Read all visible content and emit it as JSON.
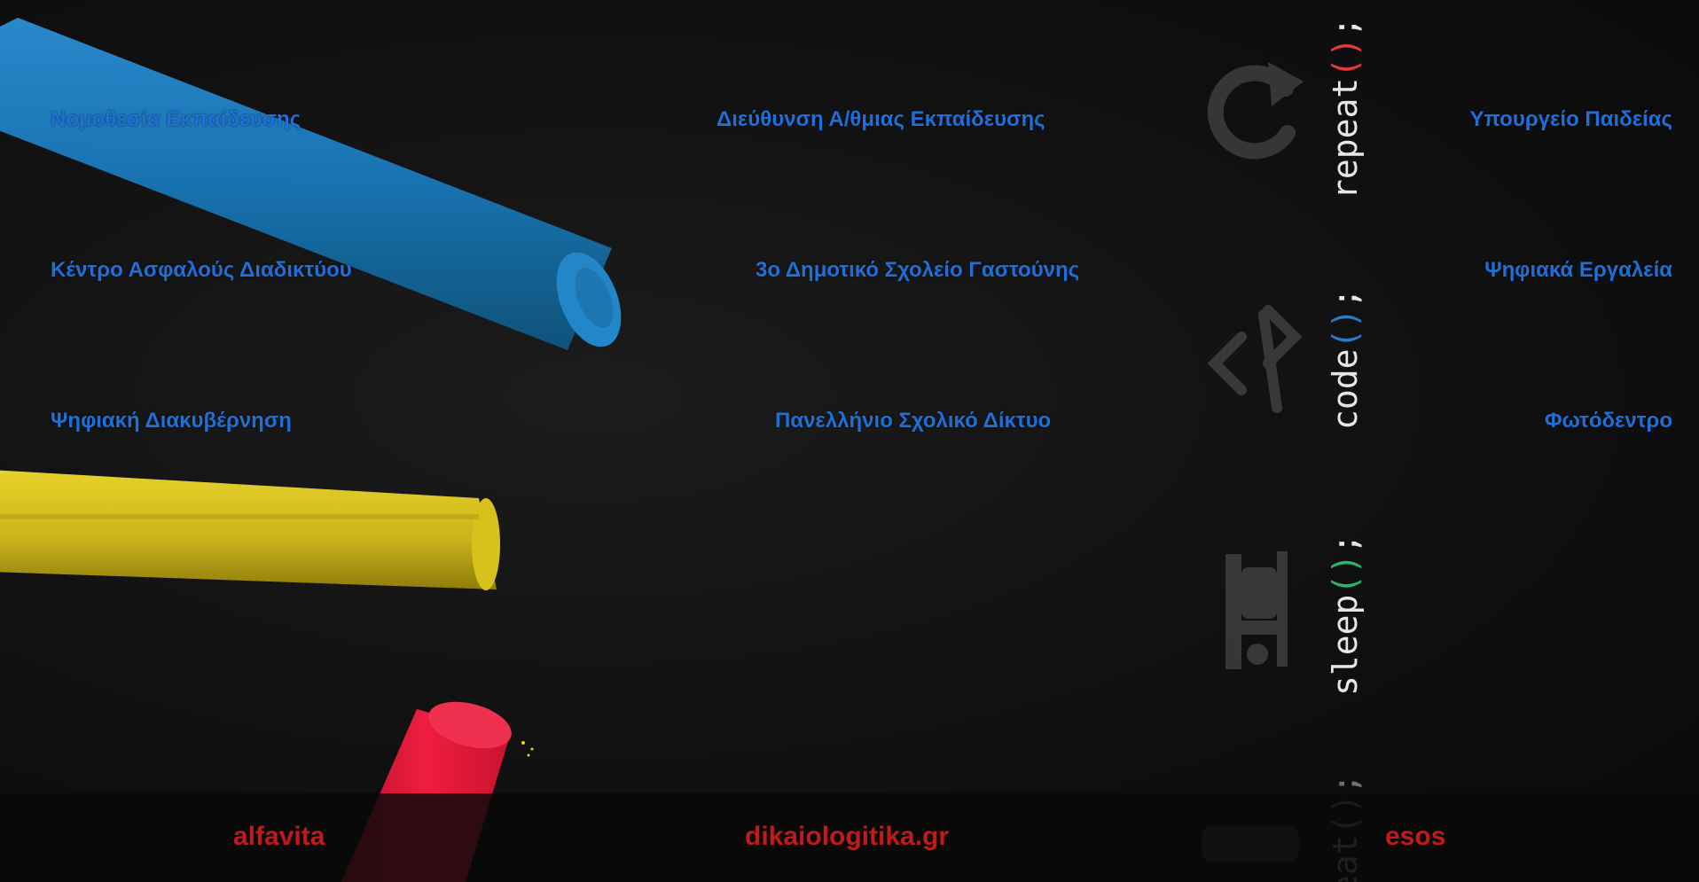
{
  "links": {
    "row1": {
      "left": "Νομοθεσία Εκπαίδευσης",
      "center": "Διεύθυνση Α/θμιας Εκπαίδευσης",
      "right": "Υπουργείο Παιδείας"
    },
    "row2": {
      "left": "Κέντρο Ασφαλούς Διαδικτύου",
      "center": "3ο Δημοτικό Σχολείο Γαστούνης",
      "right": "Ψηφιακά Εργαλεία"
    },
    "row3": {
      "left": "Ψηφιακή Διακυβέρνηση",
      "center": "Πανελλήνιο Σχολικό Δίκτυο",
      "right": "Φωτόδεντρο"
    }
  },
  "footer": {
    "links": [
      "alfavita",
      "dikaiologitika.gr",
      "esos"
    ]
  },
  "background": {
    "code_words": [
      "repeat",
      "code",
      "sleep",
      "eat"
    ],
    "code_punct": "();",
    "icons": [
      "repeat-icon",
      "code-brackets-icon",
      "sleep-bed-icon"
    ],
    "chalk_colors": {
      "blue": "#1a7fc4",
      "yellow": "#d9c21a",
      "red": "#e8183a"
    }
  },
  "colors": {
    "link": "#1f6fd8",
    "footer_link": "#c01a1a",
    "code_word": "#e6e6e6",
    "code_punct_blue": "#2b79c9",
    "code_punct_green": "#27b56a",
    "code_punct_red": "#e33a3a"
  }
}
